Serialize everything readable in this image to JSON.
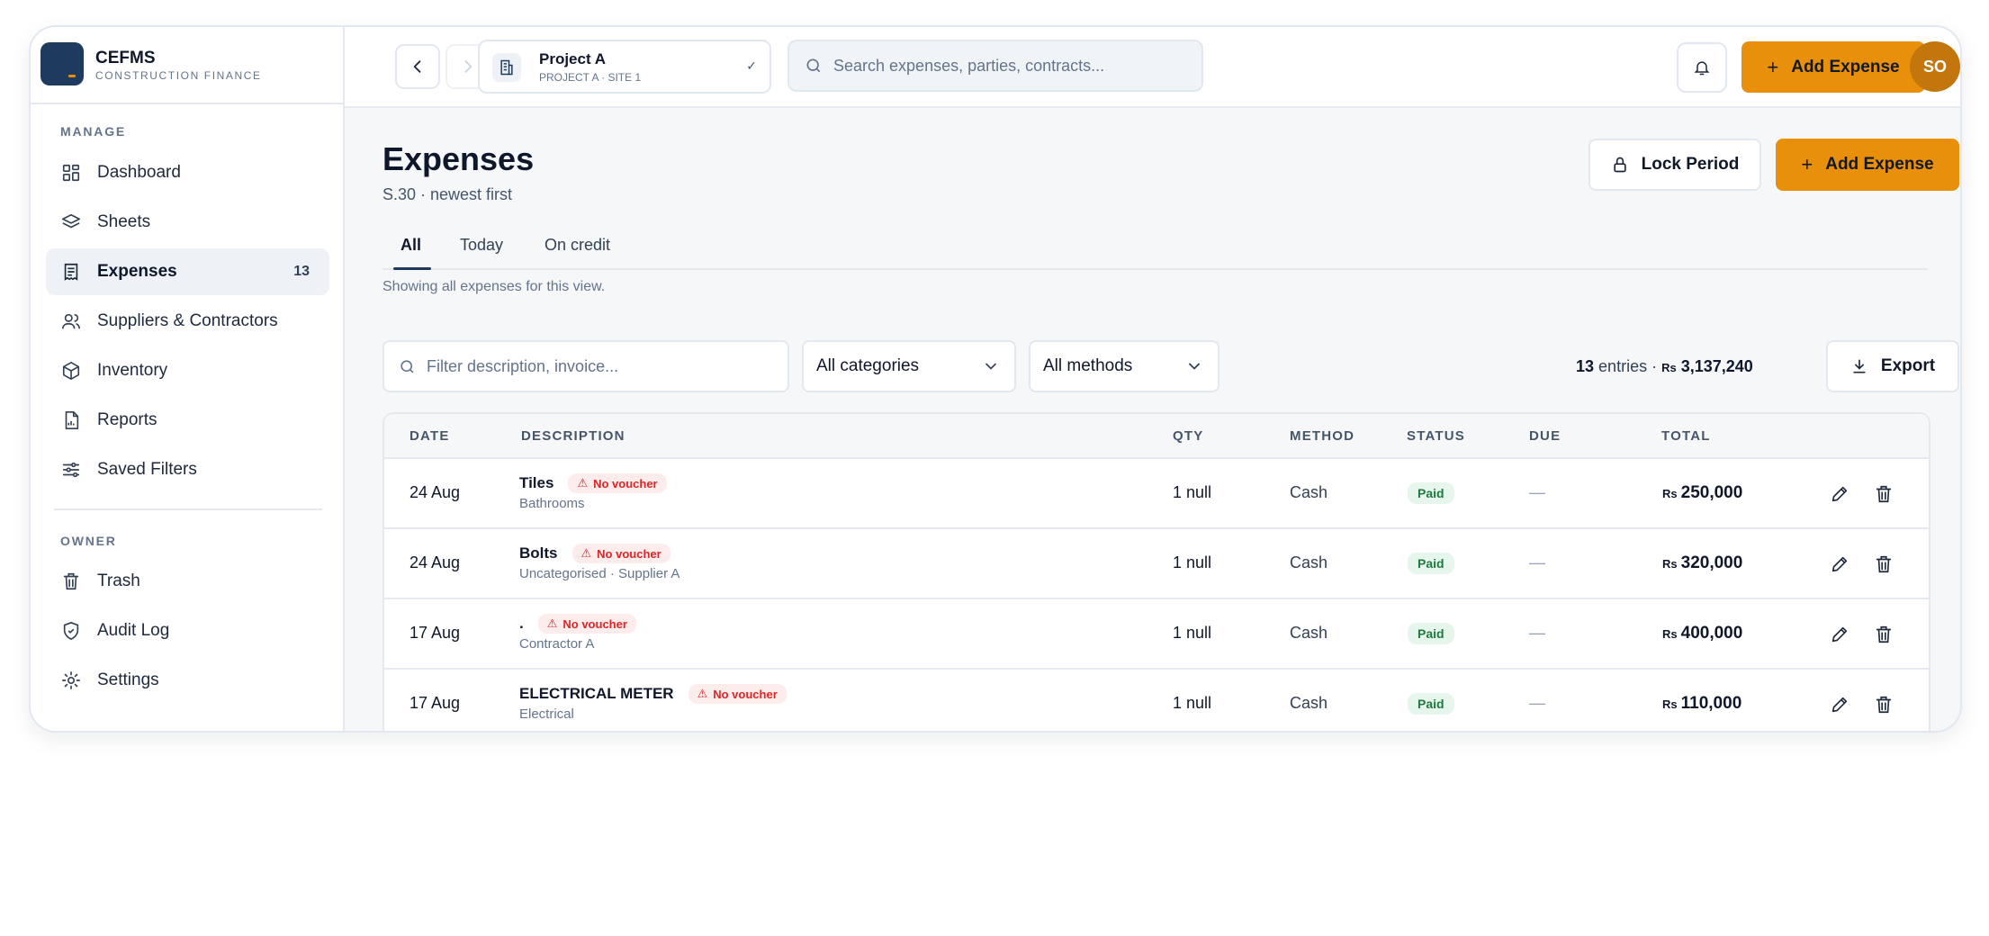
{
  "app": {
    "name": "CEFMS",
    "subtitle": "CONSTRUCTION FINANCE"
  },
  "sidebar": {
    "manage_label": "MANAGE",
    "owner_label": "OWNER",
    "manage_items": [
      {
        "label": "Dashboard",
        "icon": "grid-icon"
      },
      {
        "label": "Sheets",
        "icon": "layers-icon"
      },
      {
        "label": "Expenses",
        "icon": "receipt-icon",
        "badge": "13",
        "active": true
      },
      {
        "label": "Suppliers & Contractors",
        "icon": "users-icon"
      },
      {
        "label": "Inventory",
        "icon": "box-icon"
      },
      {
        "label": "Reports",
        "icon": "report-icon"
      },
      {
        "label": "Saved Filters",
        "icon": "sliders-icon"
      }
    ],
    "owner_items": [
      {
        "label": "Trash",
        "icon": "trash-icon"
      },
      {
        "label": "Audit Log",
        "icon": "shield-check-icon"
      },
      {
        "label": "Settings",
        "icon": "gear-icon"
      }
    ]
  },
  "topbar": {
    "project_name": "Project A",
    "project_sub": "PROJECT A · SITE 1",
    "search_placeholder": "Search expenses, parties, contracts...",
    "add_expense_label": "Add Expense",
    "avatar_initials": "SO"
  },
  "page": {
    "title": "Expenses",
    "subtitle": "S.30 · newest first",
    "lock_period_label": "Lock Period",
    "add_expense_label": "Add Expense",
    "tabs": [
      "All",
      "Today",
      "On credit"
    ],
    "active_tab": "All",
    "tab_hint": "Showing all expenses for this view.",
    "filter_placeholder": "Filter description, invoice...",
    "category_select": "All categories",
    "method_select": "All methods",
    "entries_count": "13",
    "entries_label": "entries ·",
    "entries_currency": "Rs",
    "entries_total": "3,137,240",
    "export_label": "Export"
  },
  "table": {
    "columns": [
      "DATE",
      "DESCRIPTION",
      "QTY",
      "METHOD",
      "STATUS",
      "DUE",
      "TOTAL"
    ],
    "rows": [
      {
        "date": "24 Aug",
        "description": "Tiles",
        "warning": "No voucher",
        "sub": "Bathrooms",
        "qty": "1 null",
        "method": "Cash",
        "status": "Paid",
        "due": "—",
        "currency": "Rs",
        "total": "250,000"
      },
      {
        "date": "24 Aug",
        "description": "Bolts",
        "warning": "No voucher",
        "sub": "Uncategorised · Supplier A",
        "qty": "1 null",
        "method": "Cash",
        "status": "Paid",
        "due": "—",
        "currency": "Rs",
        "total": "320,000"
      },
      {
        "date": "17 Aug",
        "description": ".",
        "warning": "No voucher",
        "sub": "Contractor A",
        "qty": "1 null",
        "method": "Cash",
        "status": "Paid",
        "due": "—",
        "currency": "Rs",
        "total": "400,000"
      },
      {
        "date": "17 Aug",
        "description": "ELECTRICAL METER",
        "warning": "No voucher",
        "sub": "Electrical",
        "qty": "1 null",
        "method": "Cash",
        "status": "Paid",
        "due": "—",
        "currency": "Rs",
        "total": "110,000"
      }
    ]
  },
  "colors": {
    "accent": "#e8900c",
    "navy": "#1e3a5f",
    "danger": "#dc2626",
    "success": "#1f7a3f"
  }
}
